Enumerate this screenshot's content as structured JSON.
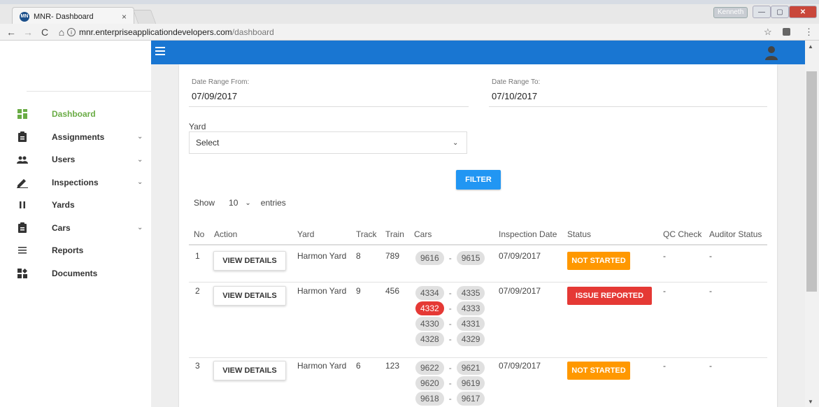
{
  "browser": {
    "tab_title": "MNR- Dashboard",
    "tab_close": "×",
    "favicon_text": "MN",
    "url_host": "mnr.enterpriseapplicationdevelopers.com",
    "url_path": "/dashboard",
    "user_chip": "Kenneth",
    "back": "←",
    "forward": "→",
    "reload": "C",
    "home": "⌂",
    "star": "☆",
    "menu": "⋮"
  },
  "sidebar": {
    "items": [
      {
        "label": "Dashboard",
        "icon": "dashboard-icon",
        "active": true
      },
      {
        "label": "Assignments",
        "icon": "clipboard-icon",
        "chevron": "⌄"
      },
      {
        "label": "Users",
        "icon": "people-icon",
        "chevron": "⌄"
      },
      {
        "label": "Inspections",
        "icon": "pencil-icon",
        "chevron": "⌄"
      },
      {
        "label": "Yards",
        "icon": "pause-icon"
      },
      {
        "label": "Cars",
        "icon": "clipboard-icon",
        "chevron": "⌄"
      },
      {
        "label": "Reports",
        "icon": "list-icon"
      },
      {
        "label": "Documents",
        "icon": "documents-icon"
      }
    ]
  },
  "filters": {
    "date_from_label": "Date Range From:",
    "date_from_value": "07/09/2017",
    "date_to_label": "Date Range To:",
    "date_to_value": "07/10/2017",
    "yard_label": "Yard",
    "yard_value": "Select",
    "filter_button": "FILTER"
  },
  "table": {
    "show_label": "Show",
    "entries_value": "10",
    "entries_label": "entries",
    "headers": [
      "No",
      "Action",
      "Yard",
      "Track",
      "Train",
      "Cars",
      "Inspection Date",
      "Status",
      "QC Check",
      "Auditor Status"
    ],
    "rows": [
      {
        "no": "1",
        "action": "VIEW DETAILS",
        "yard": "Harmon Yard",
        "track": "8",
        "train": "789",
        "cars": [
          [
            "9616",
            "9615"
          ]
        ],
        "date": "07/09/2017",
        "status": "NOT STARTED",
        "qc": "-",
        "auditor": "-"
      },
      {
        "no": "2",
        "action": "VIEW DETAILS",
        "yard": "Harmon Yard",
        "track": "9",
        "train": "456",
        "cars": [
          [
            "4334",
            "4335"
          ],
          [
            "4332",
            "4333"
          ],
          [
            "4330",
            "4331"
          ],
          [
            "4328",
            "4329"
          ]
        ],
        "date": "07/09/2017",
        "status": "ISSUE REPORTED",
        "qc": "-",
        "auditor": "-"
      },
      {
        "no": "3",
        "action": "VIEW DETAILS",
        "yard": "Harmon Yard",
        "track": "6",
        "train": "123",
        "cars": [
          [
            "9622",
            "9621"
          ],
          [
            "9620",
            "9619"
          ],
          [
            "9618",
            "9617"
          ]
        ],
        "date": "07/09/2017",
        "status": "NOT STARTED",
        "qc": "-",
        "auditor": "-"
      }
    ]
  },
  "colors": {
    "topbar": "#1976d2",
    "active_nav": "#6aac45",
    "filter_button": "#2196f3",
    "status_not_started": "#ff9800",
    "status_issue": "#e53935"
  }
}
